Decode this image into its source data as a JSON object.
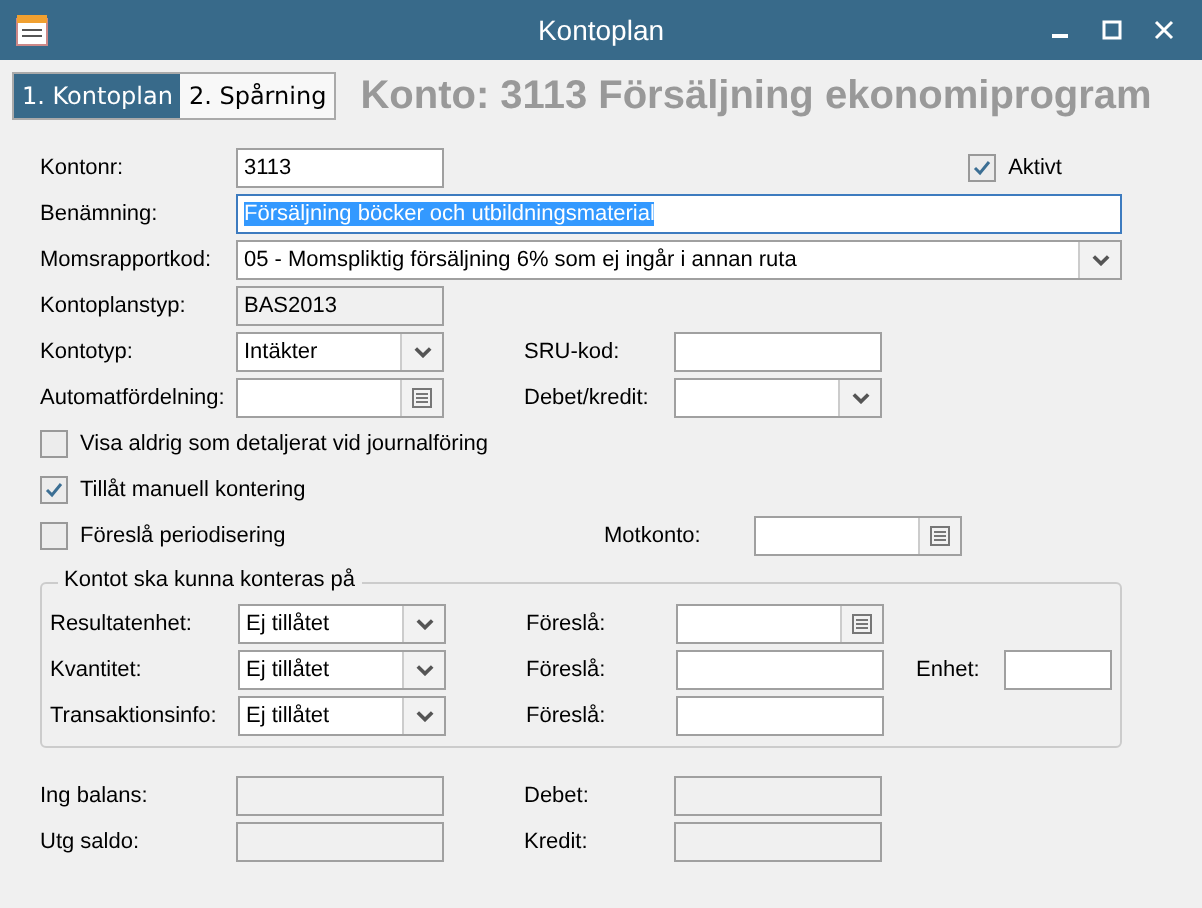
{
  "window": {
    "title": "Kontoplan"
  },
  "tabs": [
    {
      "label": "1. Kontoplan",
      "selected": true
    },
    {
      "label": "2. Spårning",
      "selected": false
    }
  ],
  "heading": "Konto: 3113 Försäljning ekonomiprogram",
  "rows": [
    [
      {
        "kind": "text",
        "label": "Kontonr:",
        "value": "3113"
      },
      {
        "kind": "check",
        "label": "Aktivt",
        "checked": true
      }
    ],
    [
      {
        "kind": "text",
        "label": "Benämning:",
        "value": "Försäljning böcker och utbildningsmaterial",
        "wide": true,
        "selected": true
      }
    ],
    [
      {
        "kind": "dropdown",
        "label": "Momsrapportkod:",
        "value": "05 - Momspliktig försäljning 6%  som ej ingår i annan ruta",
        "wide": true
      }
    ],
    [
      {
        "kind": "readonly",
        "label": "Kontoplanstyp:",
        "value": "BAS2013"
      }
    ],
    [
      {
        "kind": "dropdown",
        "label": "Kontotyp:",
        "value": "Intäkter"
      },
      {
        "kind": "text",
        "label": "SRU-kod:"
      }
    ],
    [
      {
        "kind": "lookup",
        "label": "Automatfördelning:"
      },
      {
        "kind": "dropdown",
        "label": "Debet/kredit:"
      }
    ],
    [
      {
        "kind": "check",
        "label": "Visa aldrig som detaljerat vid journalföring",
        "checked": false
      }
    ],
    [
      {
        "kind": "check",
        "label": "Tillåt manuell kontering",
        "checked": true
      }
    ],
    [
      {
        "kind": "check",
        "label": "Föreslå periodisering",
        "checked": false
      },
      {
        "kind": "lookup",
        "label": "Motkonto:"
      }
    ]
  ],
  "group": {
    "title": "Kontot ska kunna konteras på",
    "rows": [
      [
        {
          "kind": "dropdown",
          "label": "Resultatenhet:",
          "value": "Ej tillåtet"
        },
        {
          "kind": "lookup",
          "label": "Föreslå:"
        }
      ],
      [
        {
          "kind": "dropdown",
          "label": "Kvantitet:",
          "value": "Ej tillåtet"
        },
        {
          "kind": "text",
          "label": "Föreslå:"
        },
        {
          "kind": "text",
          "label": "Enhet:"
        }
      ],
      [
        {
          "kind": "dropdown",
          "label": "Transaktionsinfo:",
          "value": "Ej tillåtet"
        },
        {
          "kind": "text",
          "label": "Föreslå:"
        }
      ]
    ]
  },
  "bottom_rows": [
    [
      {
        "kind": "readonly",
        "label": "Ing balans:"
      },
      {
        "kind": "readonly",
        "label": "Debet:"
      }
    ],
    [
      {
        "kind": "readonly",
        "label": "Utg saldo:"
      },
      {
        "kind": "readonly",
        "label": "Kredit:"
      }
    ]
  ]
}
